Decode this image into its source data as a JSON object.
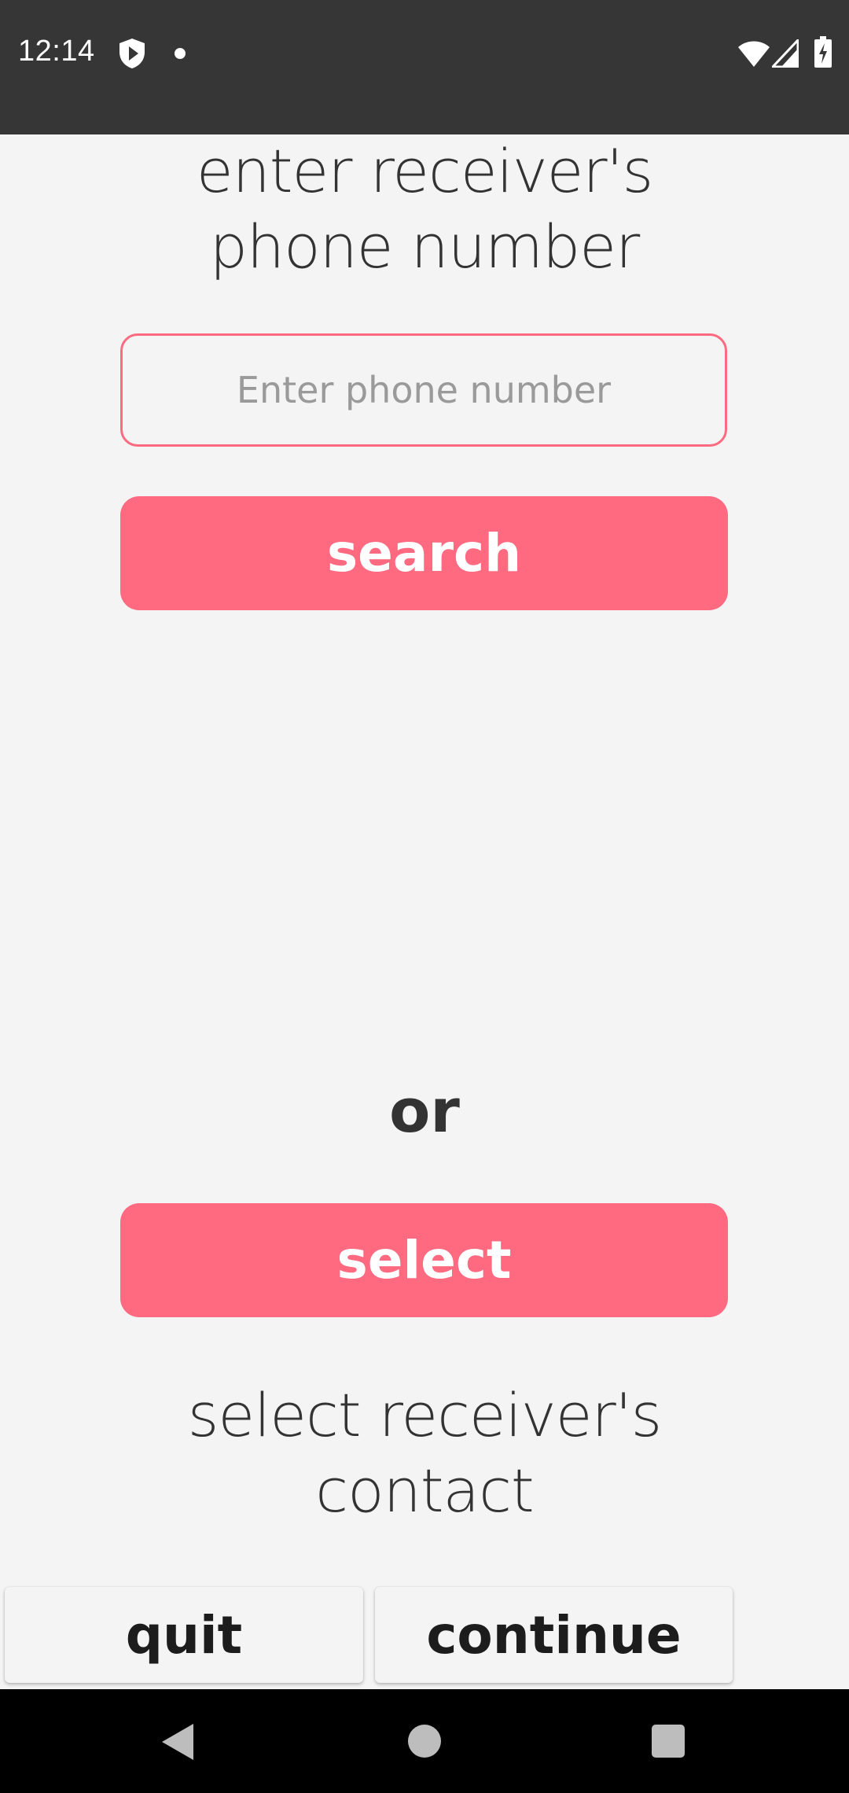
{
  "status_bar": {
    "time": "12:14",
    "icons": [
      "shield-icon",
      "notification-dot-icon",
      "wifi-icon",
      "signal-icon",
      "battery-icon"
    ]
  },
  "main": {
    "title_line1": "enter receiver's",
    "title_line2": "phone number",
    "phone_input": {
      "value": "",
      "placeholder": "Enter phone number"
    },
    "search_label": "search",
    "or_label": "or",
    "select_label": "select",
    "select_caption_line1": "select receiver's",
    "select_caption_line2": "contact"
  },
  "bottom": {
    "quit_label": "quit",
    "continue_label": "continue"
  },
  "nav_bar": {
    "icons": [
      "back-icon",
      "home-icon",
      "recents-icon"
    ]
  },
  "colors": {
    "accent": "#ff6a80",
    "background": "#f4f4f5",
    "status_bar": "#363636",
    "text": "#333333"
  }
}
